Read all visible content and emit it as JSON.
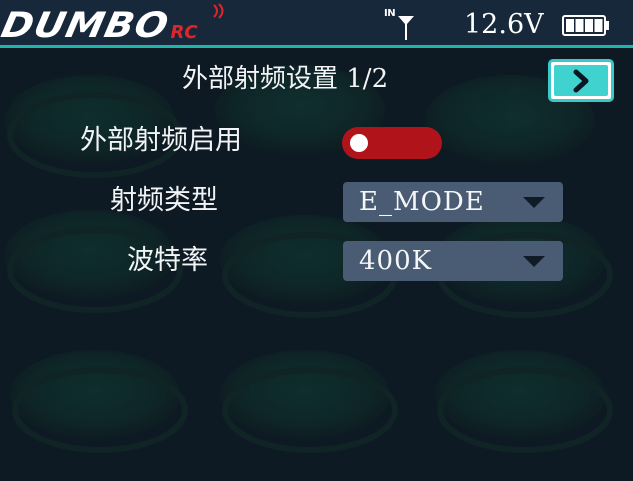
{
  "status_bar": {
    "logo_text": "DUMBO",
    "logo_sub": "RC",
    "antenna_label": "IN",
    "voltage": "12.6V",
    "battery_level": 1.0
  },
  "page": {
    "title": "外部射频设置 1/2",
    "next_icon": "chevron-right-icon"
  },
  "settings": {
    "external_rf_enable": {
      "label": "外部射频启用",
      "enabled": false
    },
    "rf_type": {
      "label": "射频类型",
      "value": "E_MODE"
    },
    "baud_rate": {
      "label": "波特率",
      "value": "400K"
    }
  },
  "colors": {
    "accent": "#3fd2cf",
    "toggle_off": "#b0141a",
    "select_bg": "#4a5c73",
    "header_bg": "#16283a",
    "background": "#0e1a23",
    "logo_red": "#e0242a"
  }
}
